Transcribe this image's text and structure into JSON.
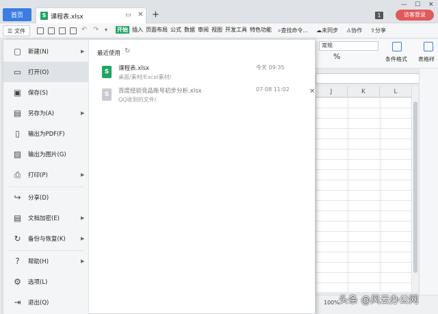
{
  "titlebar": {
    "home_tab": "首页",
    "doc_tab": "课程表.xlsx",
    "doc_icon": "S",
    "new_tab": "+",
    "count_badge": "1",
    "login": "访客登录"
  },
  "toolbar": {
    "file_label": "文件",
    "tabs": [
      "开始",
      "插入",
      "页面布局",
      "公式",
      "数据",
      "审阅",
      "视图",
      "开发工具",
      "特色功能"
    ],
    "search": "查找命令...",
    "sync": "未同步",
    "collab": "协作",
    "share": "分享"
  },
  "ribbon": {
    "number_format": "常规",
    "percent": "%",
    "cond_format": "条件格式",
    "table_style": "表格样"
  },
  "sheet": {
    "columns": [
      "J",
      "K",
      "L"
    ]
  },
  "status": {
    "zoom": "100%"
  },
  "watermark": "头条 @风云办公网",
  "file_menu": {
    "items": [
      {
        "label": "新建(N)",
        "icon": "new-doc-icon",
        "arrow": true
      },
      {
        "label": "打开(O)",
        "icon": "folder-open-icon",
        "arrow": false
      },
      {
        "label": "保存(S)",
        "icon": "save-icon",
        "arrow": false
      },
      {
        "label": "另存为(A)",
        "icon": "save-as-icon",
        "arrow": true
      },
      {
        "label": "输出为PDF(F)",
        "icon": "pdf-icon",
        "arrow": false
      },
      {
        "label": "输出为图片(G)",
        "icon": "image-icon",
        "arrow": false
      },
      {
        "label": "打印(P)",
        "icon": "print-icon",
        "arrow": true
      },
      {
        "label": "分享(D)",
        "icon": "share-icon",
        "arrow": false
      },
      {
        "label": "文档加密(E)",
        "icon": "lock-icon",
        "arrow": true
      },
      {
        "label": "备份与恢复(K)",
        "icon": "backup-icon",
        "arrow": true
      },
      {
        "label": "帮助(H)",
        "icon": "help-icon",
        "arrow": true
      },
      {
        "label": "选项(L)",
        "icon": "gear-icon",
        "arrow": false
      },
      {
        "label": "退出(Q)",
        "icon": "exit-icon",
        "arrow": false
      }
    ],
    "recent_title": "最近使用",
    "recent_files": [
      {
        "name": "课程表.xlsx",
        "path": "桌面/素材/Excel素材/",
        "time": "今天 09:35"
      },
      {
        "name": "百度经验竞品账号初步分析.xlsx",
        "path": "QQ收到的文件/",
        "time": "07-08 11:02"
      }
    ]
  }
}
